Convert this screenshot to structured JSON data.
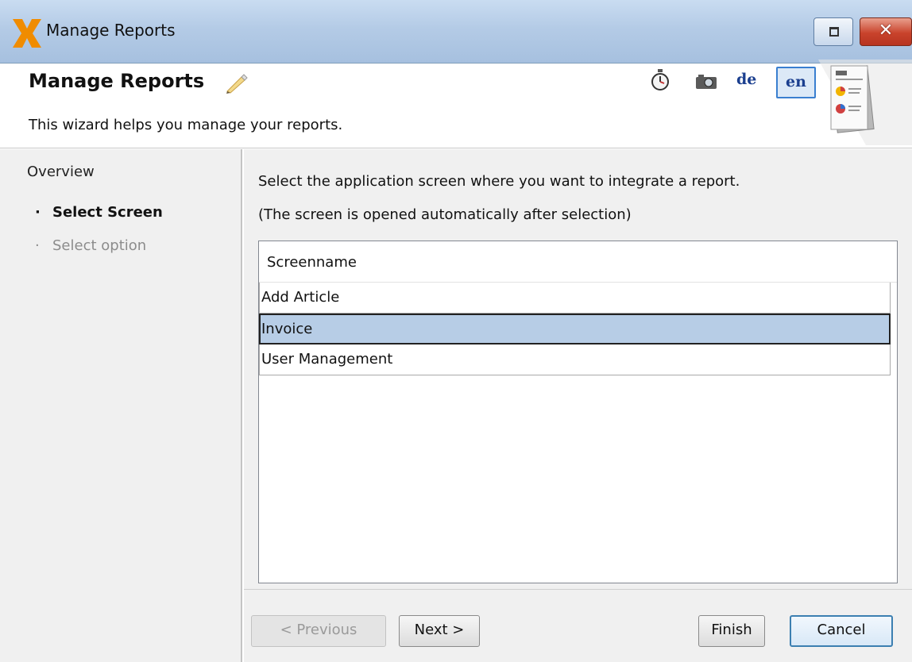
{
  "window": {
    "title": "Manage Reports",
    "restore_icon": "restore-icon",
    "close_icon": "close-icon",
    "close_glyph": "✕"
  },
  "header": {
    "title": "Manage Reports",
    "description": "This wizard helps you manage your reports.",
    "languages": [
      "de",
      "en"
    ],
    "selected_language": "en"
  },
  "nav": {
    "overview": "Overview",
    "items": [
      {
        "label": "Select Screen",
        "active": true
      },
      {
        "label": "Select option",
        "active": false
      }
    ],
    "bullet": "·"
  },
  "main": {
    "instruction": "Select the application screen where you want to integrate a report.",
    "note": "(The screen is opened automatically after selection)",
    "table": {
      "column": "Screenname",
      "rows": [
        "Add Article",
        "Invoice",
        "User Management"
      ],
      "selected": "Invoice"
    }
  },
  "buttons": {
    "previous": "< Previous",
    "next": "Next >",
    "finish": "Finish",
    "cancel": "Cancel"
  },
  "colors": {
    "title_bar": "#b4cbe6",
    "selection": "#b7cde6",
    "close_button": "#c9432c",
    "accent": "#3a7fd0"
  }
}
